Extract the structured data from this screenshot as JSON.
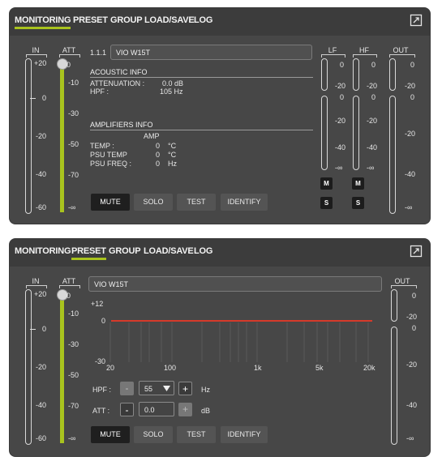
{
  "tabs": [
    "MONITORING",
    "PRESET",
    "GROUP",
    "LOAD/SAVE",
    "LOG"
  ],
  "active_colors": {
    "accent": "#a9c31e",
    "eq_line": "#d63a2a"
  },
  "meters": {
    "in_label": "IN",
    "att_label": "ATT",
    "in_scale": [
      "+20",
      "0",
      "-20",
      "-40",
      "-60"
    ],
    "att_scale": [
      "0",
      "-10",
      "-30",
      "-50",
      "-70",
      "-∞"
    ]
  },
  "monitoring": {
    "device_id": "1.1.1",
    "device_name": "VIO W15T",
    "acoustic_title": "ACOUSTIC INFO",
    "attenuation_label": "ATTENUATION :",
    "attenuation_value": "0.0 dB",
    "hpf_label": "HPF :",
    "hpf_value": "105 Hz",
    "amplifiers_title": "AMPLIFIERS INFO",
    "amp_header": "AMP",
    "temp_label": "TEMP :",
    "temp_value": "0",
    "temp_unit": "°C",
    "psu_temp_label": "PSU TEMP",
    "psu_temp_value": "0",
    "psu_temp_unit": "°C",
    "psu_freq_label": "PSU FREQ :",
    "psu_freq_value": "0",
    "psu_freq_unit": "Hz",
    "lf_label": "LF",
    "hf_label": "HF",
    "out_label": "OUT",
    "lf_scale_top": [
      "0",
      "-20"
    ],
    "lf_scale": [
      "0",
      "-20",
      "-40",
      "-∞"
    ],
    "hf_scale_top": [
      "0",
      "-20"
    ],
    "hf_scale": [
      "0",
      "-20",
      "-40",
      "-∞"
    ],
    "out_scale": [
      "0",
      "-20",
      "0",
      "-20",
      "-40",
      "-∞"
    ],
    "mute_label": "M",
    "solo_label": "S"
  },
  "preset": {
    "device_name": "VIO W15T",
    "y_top": "+12",
    "y_mid": "0",
    "y_bottom": "-30",
    "x_ticks": [
      "20",
      "100",
      "1k",
      "5k",
      "20k"
    ],
    "hpf_label": "HPF :",
    "hpf_value": "55",
    "hpf_unit": "Hz",
    "att_label": "ATT :",
    "att_value": "0.0",
    "att_unit": "dB",
    "minus": "-",
    "plus": "+",
    "out_label": "OUT",
    "out_scale": [
      "0",
      "-20",
      "0",
      "-20",
      "-40",
      "-∞"
    ]
  },
  "buttons": [
    "MUTE",
    "SOLO",
    "TEST",
    "IDENTIFY"
  ]
}
